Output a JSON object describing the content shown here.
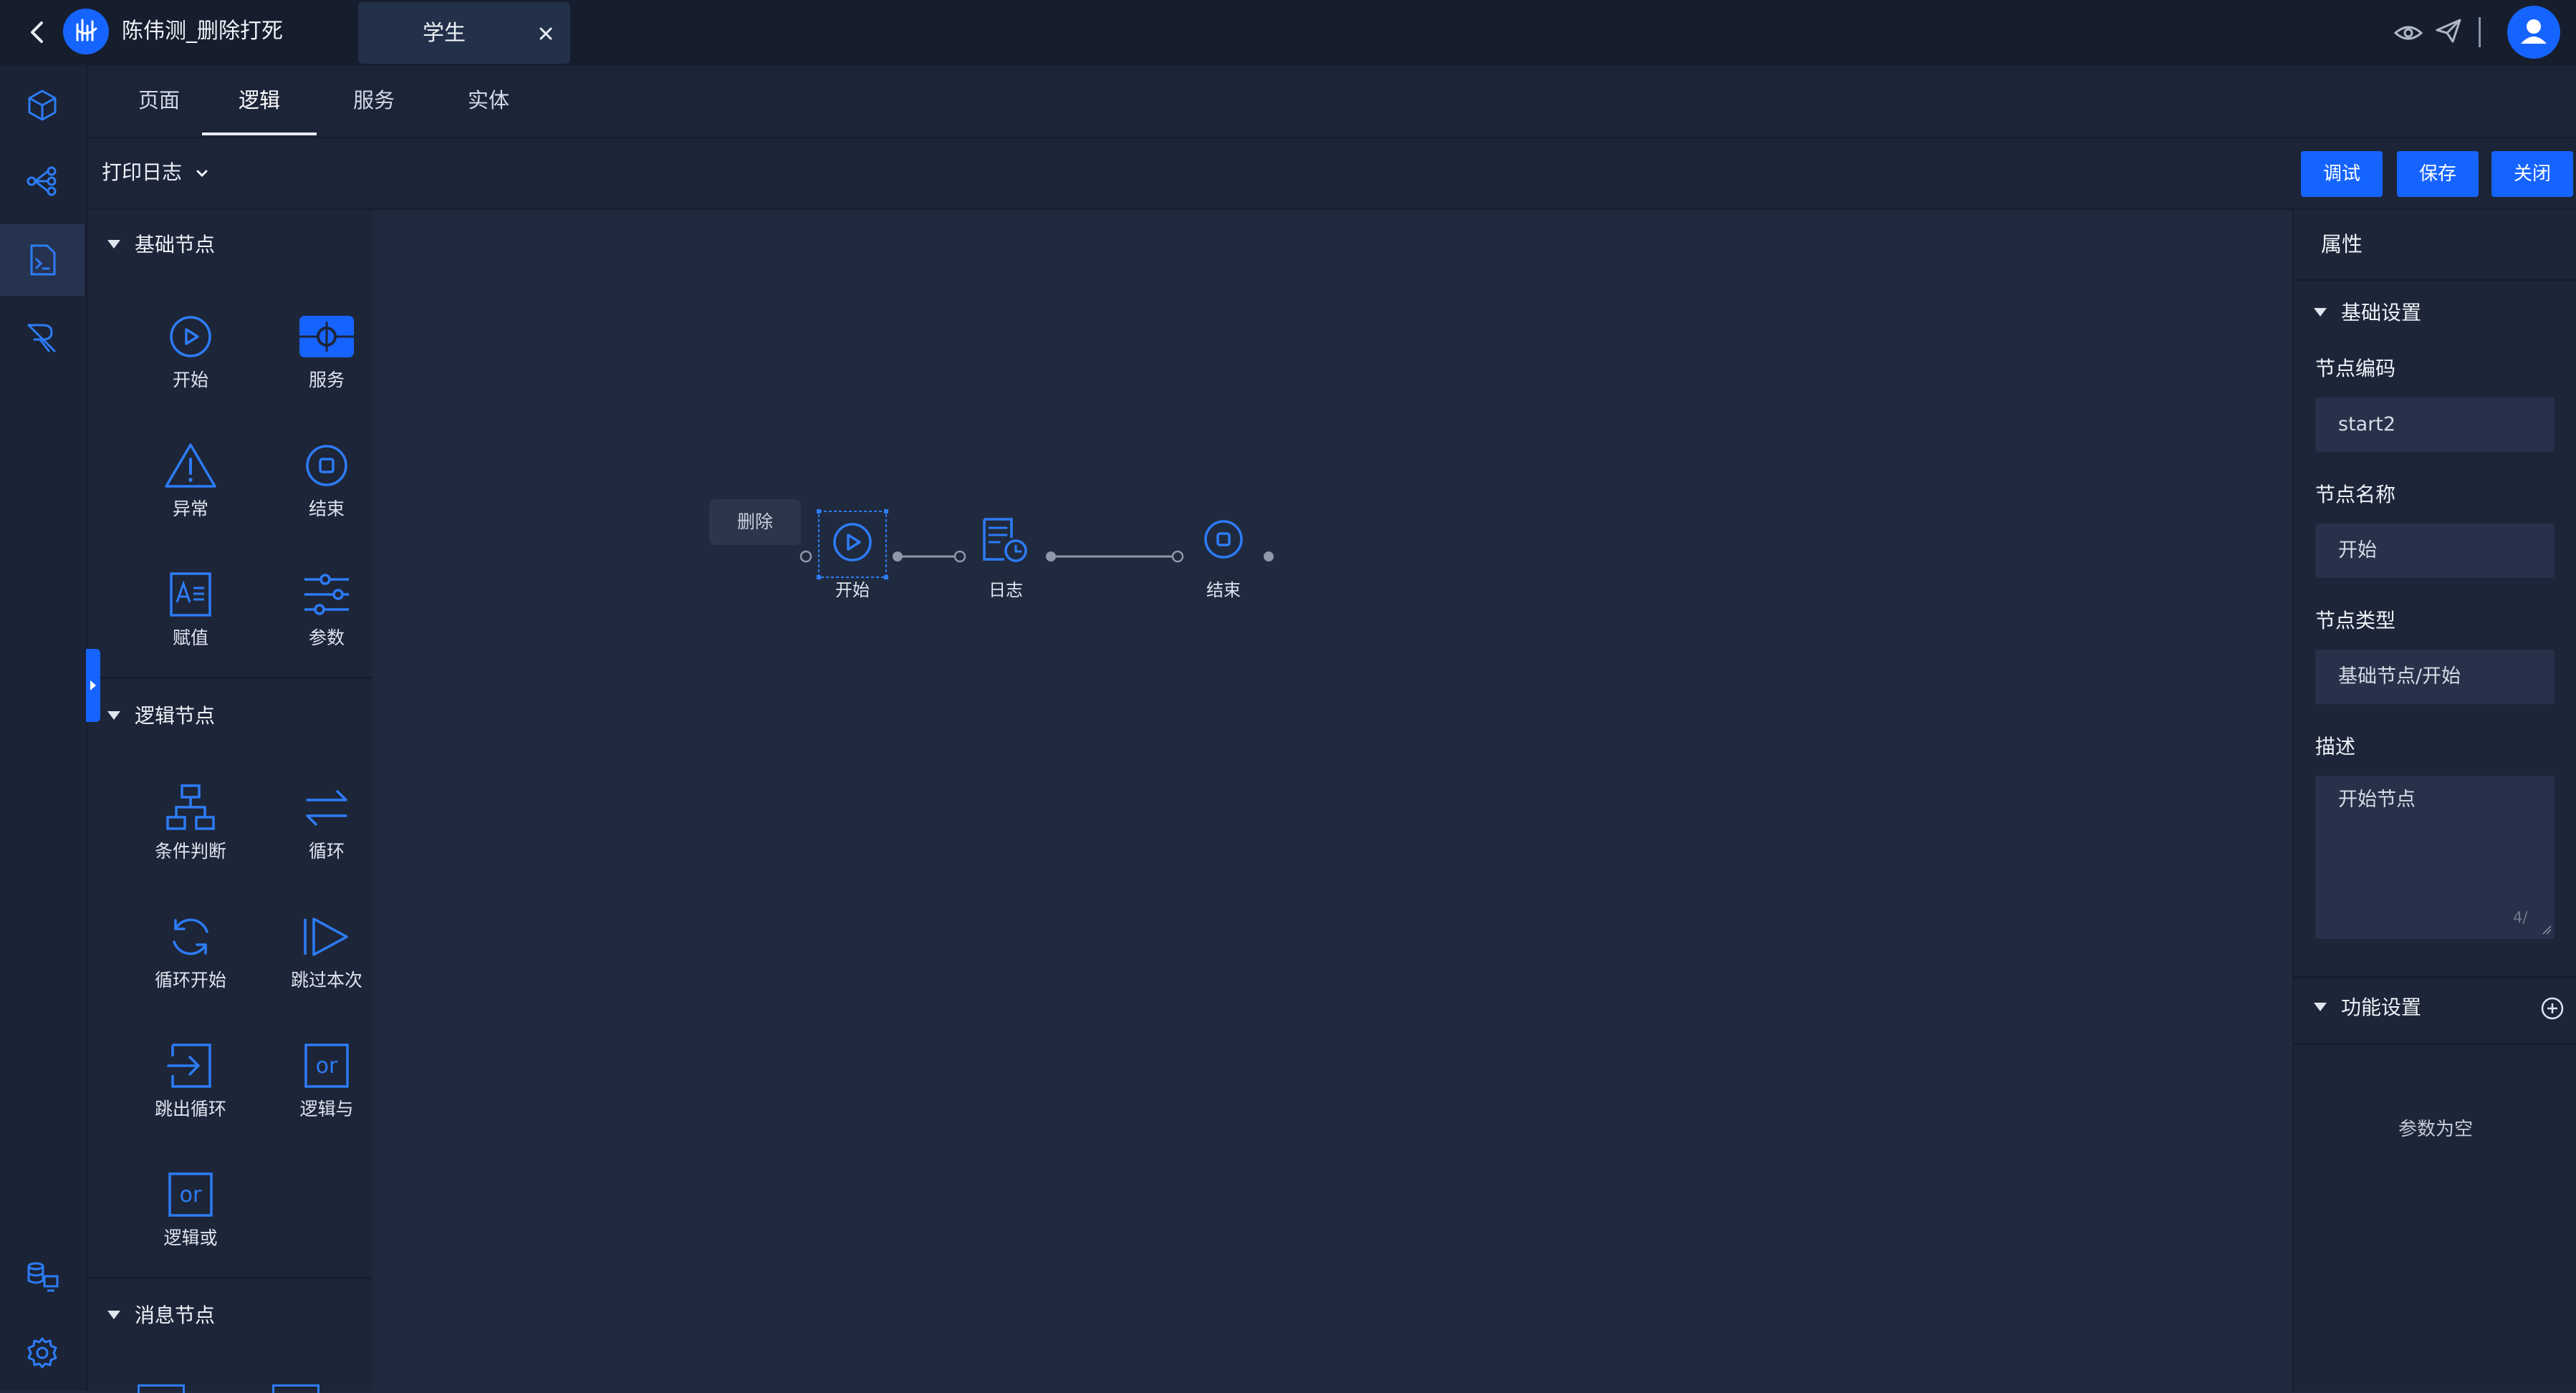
{
  "header": {
    "app_title": "陈伟测_删除打死",
    "open_tab": "学生"
  },
  "tabs": [
    "页面",
    "逻辑",
    "服务",
    "实体"
  ],
  "active_tab": "逻辑",
  "toolbar": {
    "logic_name": "打印日志",
    "debug_label": "调试",
    "save_label": "保存",
    "close_label": "关闭"
  },
  "palette": {
    "sections": [
      {
        "title": "基础节点",
        "items": [
          {
            "label": "开始",
            "icon": "play-circle-icon"
          },
          {
            "label": "服务",
            "icon": "service-icon"
          },
          {
            "label": "异常",
            "icon": "warning-icon"
          },
          {
            "label": "结束",
            "icon": "stop-circle-icon"
          },
          {
            "label": "赋值",
            "icon": "assign-icon"
          },
          {
            "label": "参数",
            "icon": "sliders-icon"
          }
        ]
      },
      {
        "title": "逻辑节点",
        "items": [
          {
            "label": "条件判断",
            "icon": "branch-icon"
          },
          {
            "label": "循环",
            "icon": "loop-arrows-icon"
          },
          {
            "label": "循环开始",
            "icon": "refresh-icon"
          },
          {
            "label": "跳过本次",
            "icon": "skip-icon"
          },
          {
            "label": "跳出循环",
            "icon": "exit-loop-icon"
          },
          {
            "label": "逻辑与",
            "icon": "logic-and-icon"
          },
          {
            "label": "逻辑或",
            "icon": "logic-or-icon"
          }
        ]
      },
      {
        "title": "消息节点",
        "items": []
      }
    ]
  },
  "canvas": {
    "delete_label": "删除",
    "nodes": [
      {
        "label": "开始",
        "icon": "play-circle-icon",
        "selected": true
      },
      {
        "label": "日志",
        "icon": "log-icon",
        "selected": false
      },
      {
        "label": "结束",
        "icon": "stop-circle-icon",
        "selected": false
      }
    ]
  },
  "properties": {
    "title": "属性",
    "basic_section": "基础设置",
    "node_code_label": "节点编码",
    "node_code": "start2",
    "node_name_label": "节点名称",
    "node_name": "开始",
    "node_type_label": "节点类型",
    "node_type": "基础节点/开始",
    "description_label": "描述",
    "description": "开始节点",
    "description_count": "4/",
    "function_section": "功能设置",
    "params_empty": "参数为空"
  },
  "colors": {
    "accent": "#1664ff",
    "background": "#202a3f",
    "panel": "#1d2538",
    "topbar": "#161d2d",
    "node_blue": "#2d7cf6"
  }
}
